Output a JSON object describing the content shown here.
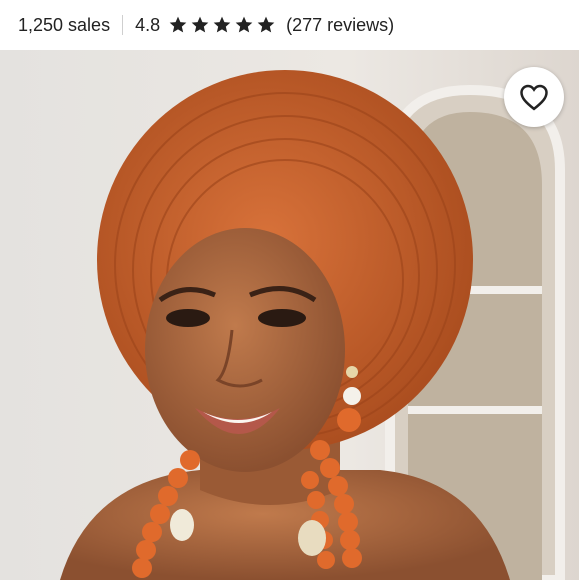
{
  "listing": {
    "sales": "1,250 sales",
    "rating": "4.8",
    "stars": 5,
    "reviews": "(277 reviews)"
  },
  "product_image": {
    "alt": "Woman wearing orange auto gele headwrap with coral bead necklace and earrings",
    "colors": {
      "headwrap": "#c8622a",
      "background": "#e9e4df",
      "skin": "#a5663f",
      "beads": "#e06a2c"
    }
  },
  "favorite": {
    "icon": "heart-icon",
    "label": "Add to favorites"
  }
}
